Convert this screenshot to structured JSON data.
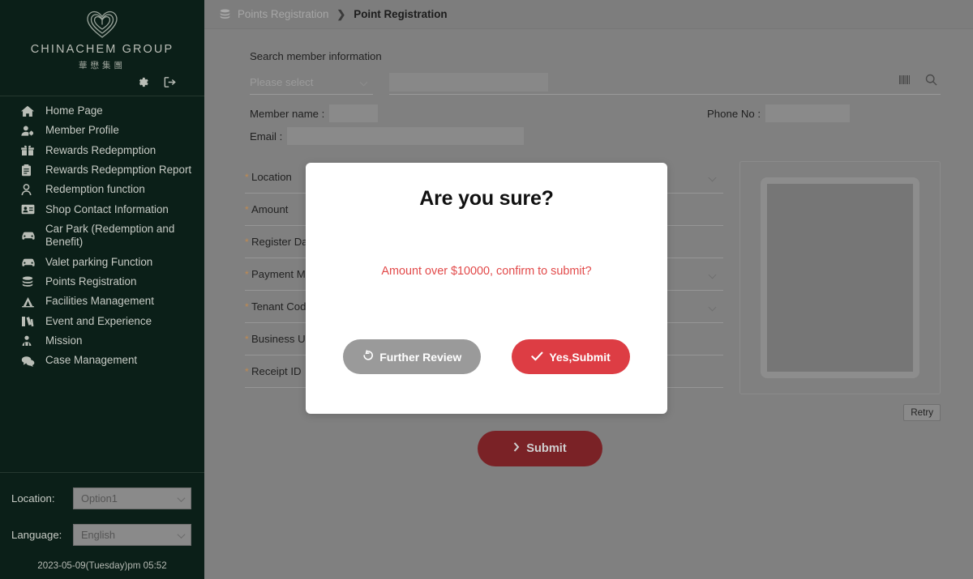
{
  "sidebar": {
    "brand": {
      "logo_icon": "heart-maze-logo",
      "name": "CHINACHEM GROUP",
      "name_cn": "華懋集團"
    },
    "actions": [
      {
        "name": "settings-icon",
        "label": "Settings"
      },
      {
        "name": "logout-icon",
        "label": "Logout"
      }
    ],
    "items": [
      {
        "label": "Home Page",
        "icon": "home-icon"
      },
      {
        "label": "Member Profile",
        "icon": "user-gear-icon"
      },
      {
        "label": "Rewards Redepmption",
        "icon": "gift-icon"
      },
      {
        "label": "Rewards Redepmption Report",
        "icon": "clipboard-icon"
      },
      {
        "label": "Redemption function",
        "icon": "person-icon"
      },
      {
        "label": "Shop Contact Information",
        "icon": "id-card-icon"
      },
      {
        "label": "Car Park (Redemption and Benefit)",
        "icon": "car-icon"
      },
      {
        "label": "Valet parking Function",
        "icon": "car-icon"
      },
      {
        "label": "Points Registration",
        "icon": "coins-icon"
      },
      {
        "label": "Facilities Management",
        "icon": "facilities-icon"
      },
      {
        "label": "Event and Experience",
        "icon": "event-icon"
      },
      {
        "label": "Mission",
        "icon": "mission-icon"
      },
      {
        "label": "Case Management",
        "icon": "chat-icon"
      }
    ],
    "footer": {
      "location_label": "Location:",
      "location_value": "Option1",
      "language_label": "Language:",
      "language_value": "English",
      "clock": "2023-05-09(Tuesday)pm 05:52"
    }
  },
  "topbar": {
    "breadcrumb_icon": "coins-icon",
    "parent": "Points Registration",
    "separator": "❯",
    "current": "Point Registration"
  },
  "search": {
    "title": "Search member information",
    "select_placeholder": "Please select",
    "input_value": "",
    "barcode_icon": "barcode-icon",
    "search_icon": "search-icon"
  },
  "member": {
    "name_label": "Member name :",
    "name_value": "",
    "phone_label": "Phone No :",
    "phone_value": "",
    "email_label": "Email :",
    "email_value": ""
  },
  "form": {
    "required_mark": "*",
    "fields": [
      {
        "label": "Location",
        "type": "select",
        "value": ""
      },
      {
        "label": "Amount",
        "type": "text",
        "value": ""
      },
      {
        "label": "Register Date",
        "type": "text",
        "value": ""
      },
      {
        "label": "Payment Method",
        "type": "select",
        "value": ""
      },
      {
        "label": "Tenant Code",
        "type": "select",
        "value": ""
      },
      {
        "label": "Business Unit",
        "type": "text",
        "value": ""
      },
      {
        "label": "Receipt ID",
        "type": "text",
        "value": ""
      }
    ],
    "upload": {
      "name": "receipt-image-preview",
      "retry_label": "Retry"
    },
    "submit_label": "Submit",
    "submit_icon": "chevron-right-icon"
  },
  "modal": {
    "title": "Are you sure?",
    "message": "Amount over $10000, confirm to submit?",
    "review_label": "Further Review",
    "review_icon": "undo-icon",
    "confirm_label": "Yes,Submit",
    "confirm_icon": "check-icon"
  },
  "colors": {
    "sidebar_bg": "#0b1f18",
    "overlay": "#808080",
    "accent_red": "#dd3d44",
    "submit_red": "#7a2226",
    "required_orange": "#c08a50",
    "modal_text_red": "#e24a4a"
  }
}
